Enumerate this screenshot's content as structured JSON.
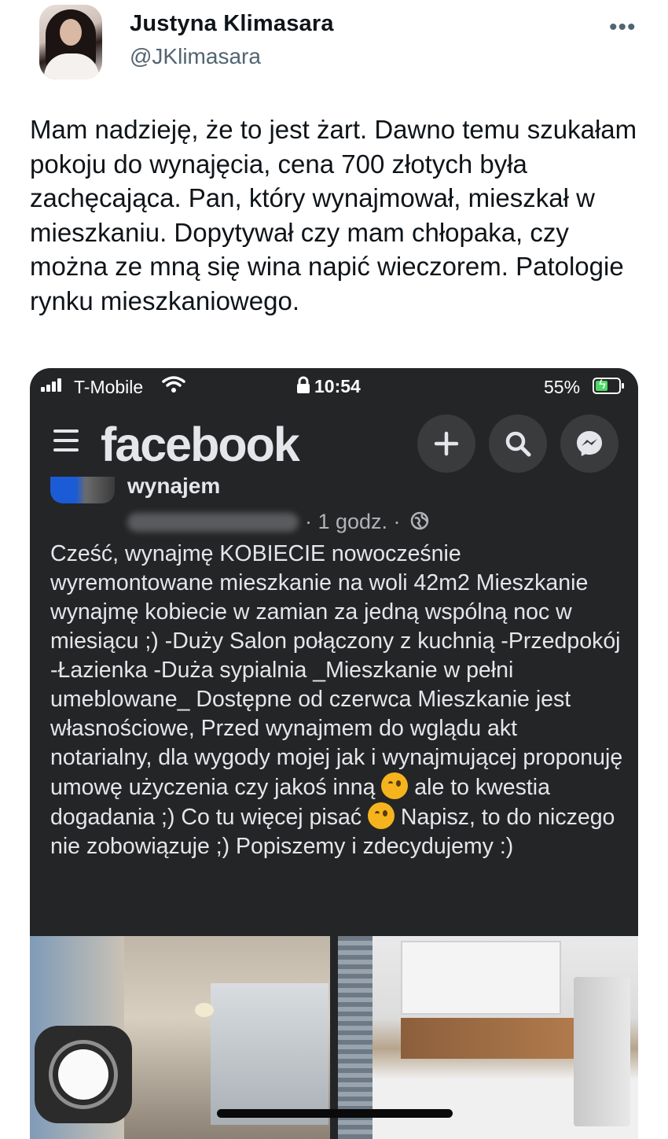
{
  "tweet": {
    "display_name": "Justyna Klimasara",
    "handle": "@JKlimasara",
    "more_icon": "more-horizontal-icon",
    "text": "Mam nadzieję, że to jest żart. Dawno temu szukałam pokoju do wynajęcia, cena 700 złotych była zachęcająca. Pan, który wynajmował, mieszkał w mieszkaniu. Dopytywał czy mam chłopaka, czy można ze mną się wina napić wieczorem. Patologie rynku mieszkaniowego."
  },
  "phone_status": {
    "carrier": "T-Mobile",
    "time": "10:54",
    "battery": "55%",
    "battery_level": 0.55
  },
  "facebook": {
    "logo": "facebook",
    "group_name": "wynajem",
    "post_meta": "· 1 godz. ·",
    "post_text_1": "Cześć, wynajmę KOBIECIE nowocześnie wyremontowane mieszkanie na woli 42m2 Mieszkanie wynajmę kobiecie w zamian za jedną wspólną noc w miesiącu ;) -Duży Salon połączony z kuchnią -Przedpokój -Łazienka -Duża sypialnia _Mieszkanie w pełni umeblowane_ Dostępne od czerwca  Mieszkanie jest własnościowe, Przed wynajmem do wglądu akt notarialny, dla wygody mojej jak i wynajmującej proponuję umowę użyczenia czy jakoś inną ",
    "post_text_2": " ale to kwestia dogadania ;)  Co tu więcej pisać ",
    "post_text_3": " Napisz, to do niczego nie zobowiązuje ;) Popiszemy i zdecydujemy :)"
  },
  "colors": {
    "tweet_text": "#0f1419",
    "handle": "#536471",
    "fb_background": "#242526",
    "fb_text": "#e4e6eb",
    "fb_meta": "#b0b3b8",
    "battery_green": "#4cd964"
  }
}
